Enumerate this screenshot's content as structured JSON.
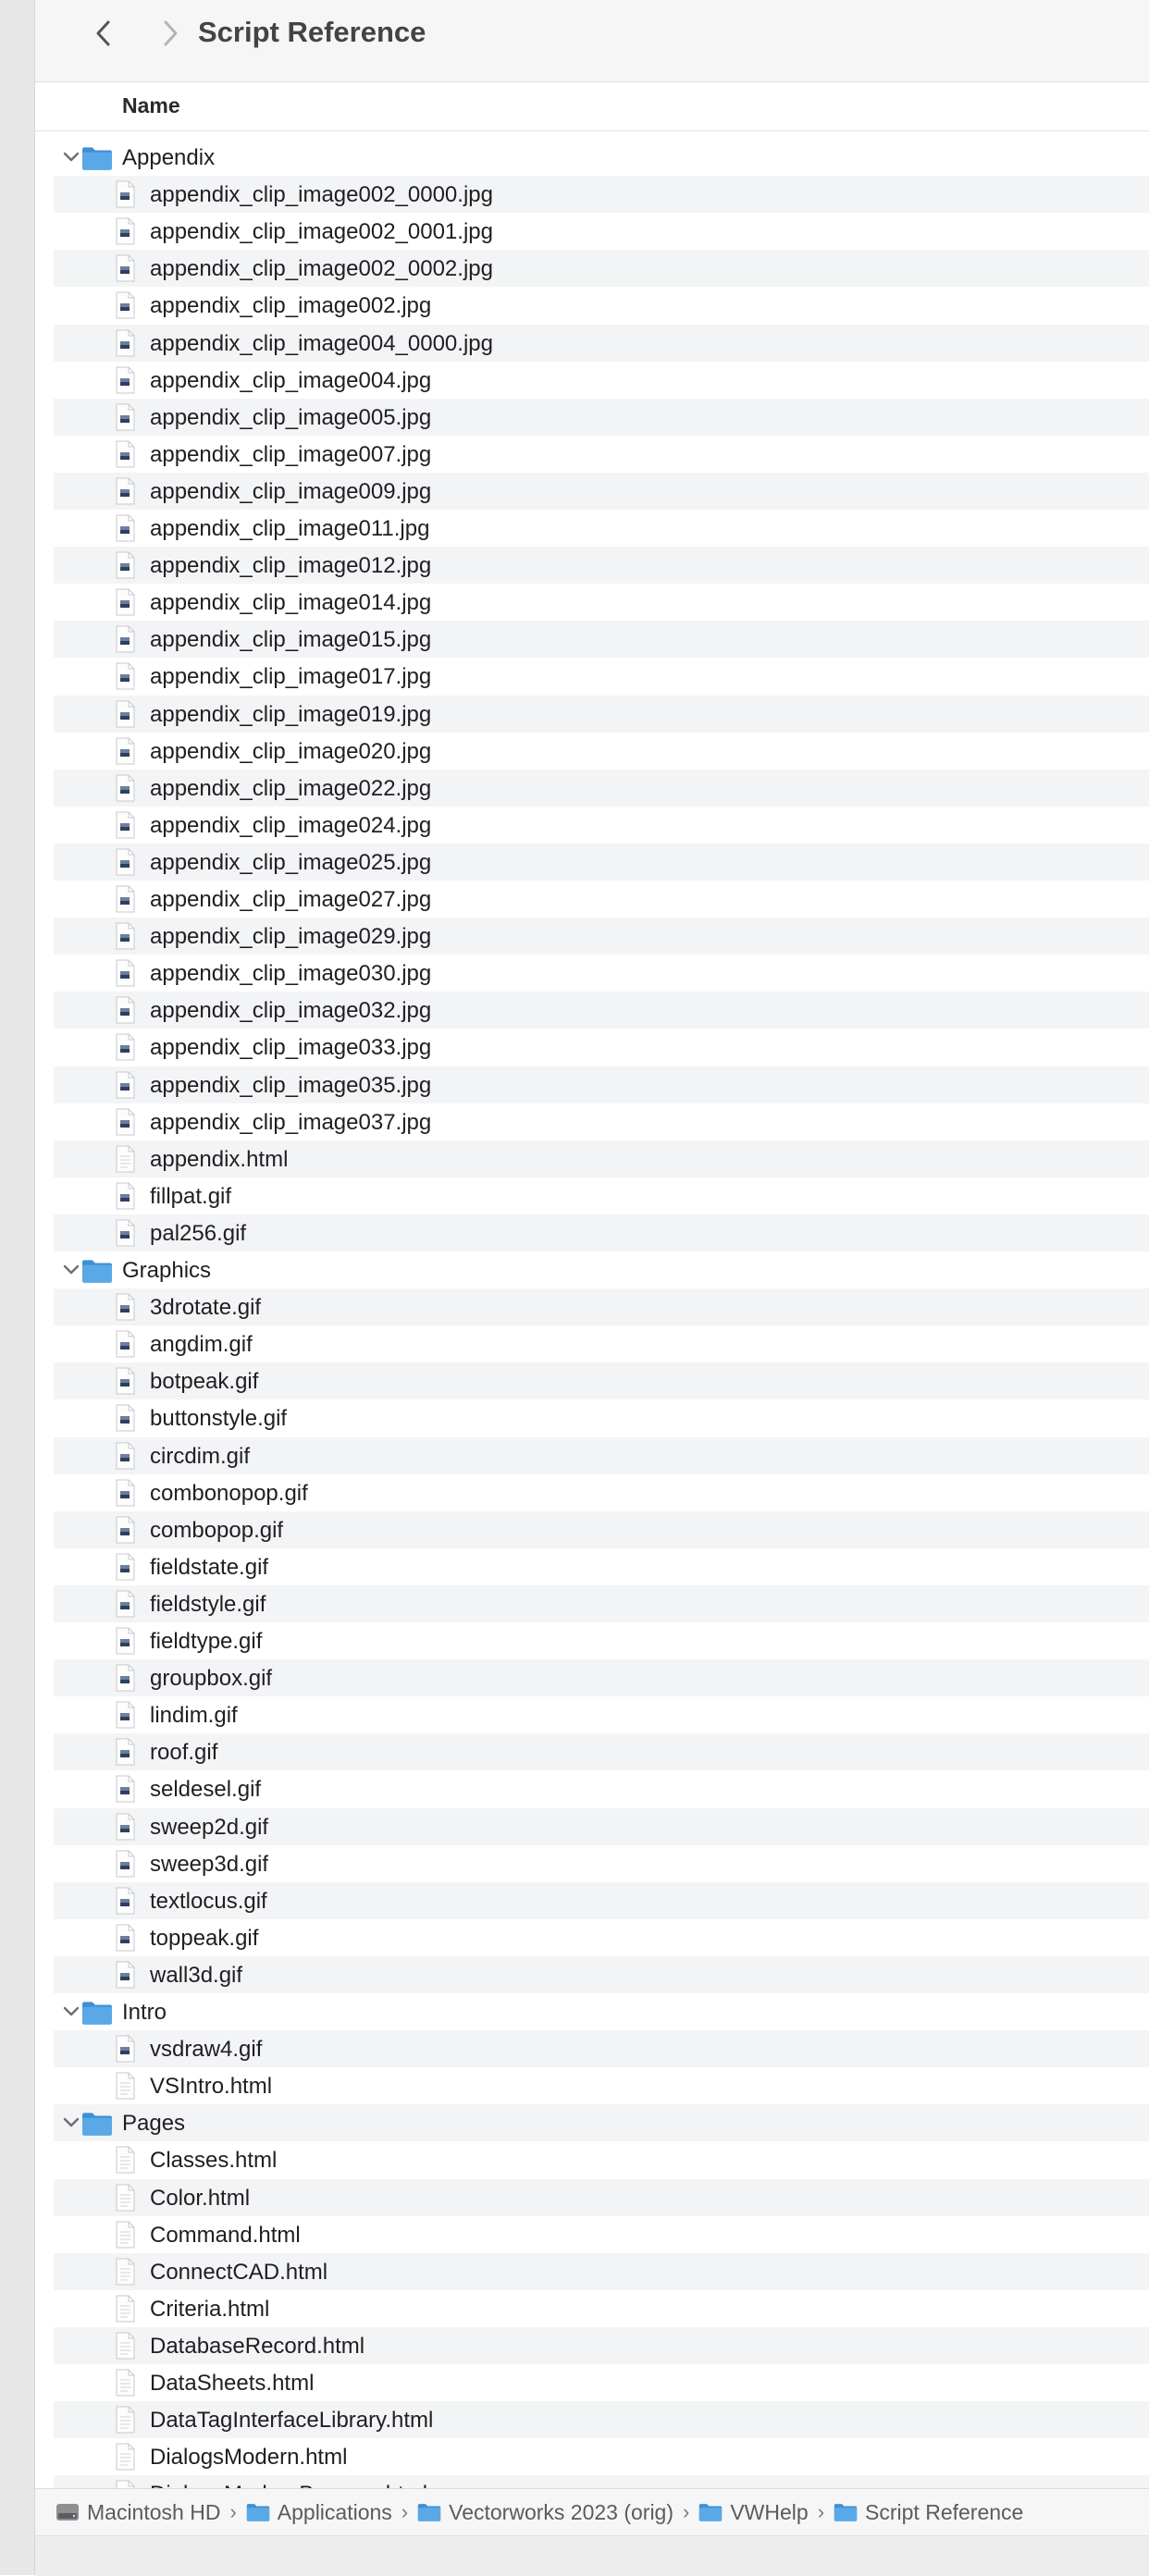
{
  "window": {
    "title": "Script Reference"
  },
  "columns": {
    "name_label": "Name"
  },
  "items": [
    {
      "label": "Appendix",
      "type": "folder",
      "level": 0
    },
    {
      "label": "appendix_clip_image002_0000.jpg",
      "type": "image",
      "level": 1
    },
    {
      "label": "appendix_clip_image002_0001.jpg",
      "type": "image",
      "level": 1
    },
    {
      "label": "appendix_clip_image002_0002.jpg",
      "type": "image",
      "level": 1
    },
    {
      "label": "appendix_clip_image002.jpg",
      "type": "image",
      "level": 1
    },
    {
      "label": "appendix_clip_image004_0000.jpg",
      "type": "image",
      "level": 1
    },
    {
      "label": "appendix_clip_image004.jpg",
      "type": "image",
      "level": 1
    },
    {
      "label": "appendix_clip_image005.jpg",
      "type": "image",
      "level": 1
    },
    {
      "label": "appendix_clip_image007.jpg",
      "type": "image",
      "level": 1
    },
    {
      "label": "appendix_clip_image009.jpg",
      "type": "image",
      "level": 1
    },
    {
      "label": "appendix_clip_image011.jpg",
      "type": "image",
      "level": 1
    },
    {
      "label": "appendix_clip_image012.jpg",
      "type": "image",
      "level": 1
    },
    {
      "label": "appendix_clip_image014.jpg",
      "type": "image",
      "level": 1
    },
    {
      "label": "appendix_clip_image015.jpg",
      "type": "image",
      "level": 1
    },
    {
      "label": "appendix_clip_image017.jpg",
      "type": "image",
      "level": 1
    },
    {
      "label": "appendix_clip_image019.jpg",
      "type": "image",
      "level": 1
    },
    {
      "label": "appendix_clip_image020.jpg",
      "type": "image",
      "level": 1
    },
    {
      "label": "appendix_clip_image022.jpg",
      "type": "image",
      "level": 1
    },
    {
      "label": "appendix_clip_image024.jpg",
      "type": "image",
      "level": 1
    },
    {
      "label": "appendix_clip_image025.jpg",
      "type": "image",
      "level": 1
    },
    {
      "label": "appendix_clip_image027.jpg",
      "type": "image",
      "level": 1
    },
    {
      "label": "appendix_clip_image029.jpg",
      "type": "image",
      "level": 1
    },
    {
      "label": "appendix_clip_image030.jpg",
      "type": "image",
      "level": 1
    },
    {
      "label": "appendix_clip_image032.jpg",
      "type": "image",
      "level": 1
    },
    {
      "label": "appendix_clip_image033.jpg",
      "type": "image",
      "level": 1
    },
    {
      "label": "appendix_clip_image035.jpg",
      "type": "image",
      "level": 1
    },
    {
      "label": "appendix_clip_image037.jpg",
      "type": "image",
      "level": 1
    },
    {
      "label": "appendix.html",
      "type": "doc",
      "level": 1
    },
    {
      "label": "fillpat.gif",
      "type": "image",
      "level": 1
    },
    {
      "label": "pal256.gif",
      "type": "image",
      "level": 1
    },
    {
      "label": "Graphics",
      "type": "folder",
      "level": 0
    },
    {
      "label": "3drotate.gif",
      "type": "image",
      "level": 1
    },
    {
      "label": "angdim.gif",
      "type": "image",
      "level": 1
    },
    {
      "label": "botpeak.gif",
      "type": "image",
      "level": 1
    },
    {
      "label": "buttonstyle.gif",
      "type": "image",
      "level": 1
    },
    {
      "label": "circdim.gif",
      "type": "image",
      "level": 1
    },
    {
      "label": "combonopop.gif",
      "type": "image",
      "level": 1
    },
    {
      "label": "combopop.gif",
      "type": "image",
      "level": 1
    },
    {
      "label": "fieldstate.gif",
      "type": "image",
      "level": 1
    },
    {
      "label": "fieldstyle.gif",
      "type": "image",
      "level": 1
    },
    {
      "label": "fieldtype.gif",
      "type": "image",
      "level": 1
    },
    {
      "label": "groupbox.gif",
      "type": "image",
      "level": 1
    },
    {
      "label": "lindim.gif",
      "type": "image",
      "level": 1
    },
    {
      "label": "roof.gif",
      "type": "image",
      "level": 1
    },
    {
      "label": "seldesel.gif",
      "type": "image",
      "level": 1
    },
    {
      "label": "sweep2d.gif",
      "type": "image",
      "level": 1
    },
    {
      "label": "sweep3d.gif",
      "type": "image",
      "level": 1
    },
    {
      "label": "textlocus.gif",
      "type": "image",
      "level": 1
    },
    {
      "label": "toppeak.gif",
      "type": "image",
      "level": 1
    },
    {
      "label": "wall3d.gif",
      "type": "image",
      "level": 1
    },
    {
      "label": "Intro",
      "type": "folder",
      "level": 0
    },
    {
      "label": "vsdraw4.gif",
      "type": "image",
      "level": 1
    },
    {
      "label": "VSIntro.html",
      "type": "doc",
      "level": 1
    },
    {
      "label": "Pages",
      "type": "folder",
      "level": 0
    },
    {
      "label": "Classes.html",
      "type": "doc",
      "level": 1
    },
    {
      "label": "Color.html",
      "type": "doc",
      "level": 1
    },
    {
      "label": "Command.html",
      "type": "doc",
      "level": 1
    },
    {
      "label": "ConnectCAD.html",
      "type": "doc",
      "level": 1
    },
    {
      "label": "Criteria.html",
      "type": "doc",
      "level": 1
    },
    {
      "label": "DatabaseRecord.html",
      "type": "doc",
      "level": 1
    },
    {
      "label": "DataSheets.html",
      "type": "doc",
      "level": 1
    },
    {
      "label": "DataTagInterfaceLibrary.html",
      "type": "doc",
      "level": 1
    },
    {
      "label": "DialogsModern.html",
      "type": "doc",
      "level": 1
    },
    {
      "label": "DialogsModernBrowser.html",
      "type": "doc",
      "level": 1
    }
  ],
  "pathbar": [
    {
      "label": "Macintosh HD",
      "icon": "hard-drive-icon"
    },
    {
      "label": "Applications",
      "icon": "folder-icon"
    },
    {
      "label": "Vectorworks 2023 (orig)",
      "icon": "folder-icon"
    },
    {
      "label": "VWHelp",
      "icon": "folder-icon"
    },
    {
      "label": "Script Reference",
      "icon": "folder-icon"
    }
  ],
  "pathbar_separator": "›",
  "colors": {
    "folder": "#5aa9e6",
    "folder_dark": "#3d8fd6",
    "stripe": "#f3f4f5"
  }
}
